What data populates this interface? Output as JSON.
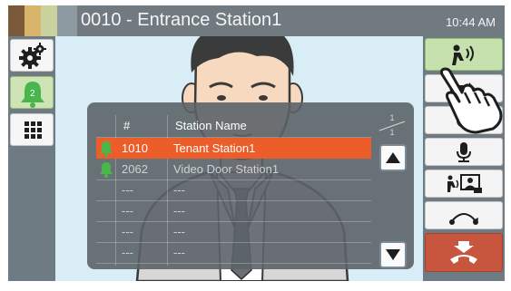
{
  "title_bar": {
    "station_title": "0010 - Entrance Station1",
    "time": "10:44 AM"
  },
  "left_panel": {
    "settings_button": "gear-icon",
    "call_status_button": {
      "icon": "bell-icon",
      "badge": "2"
    },
    "keypad_button": "keypad-icon"
  },
  "station_list": {
    "columns": {
      "number": "#",
      "name": "Station Name"
    },
    "page": {
      "current": "1",
      "total": "1"
    },
    "rows": [
      {
        "status_icon": "bell-icon",
        "number": "1010",
        "name": "Tenant Station1",
        "selected": true
      },
      {
        "status_icon": "bell-icon",
        "number": "2062",
        "name": "Video Door Station1",
        "selected": false
      },
      {
        "number": "---",
        "name": "---"
      },
      {
        "number": "---",
        "name": "---"
      },
      {
        "number": "---",
        "name": "---"
      },
      {
        "number": "---",
        "name": "---"
      }
    ],
    "colors": {
      "selected_row": "#ec5d29",
      "bell_icon": "#48b64a"
    }
  },
  "right_panel": {
    "buttons": [
      "call-individual-icon",
      "phone-transfer-icon",
      "record-icon",
      "microphone-icon",
      "page-display-icon",
      "hold-icon",
      "end-call-icon"
    ],
    "colors": {
      "active": "#c6e1ad",
      "end_call": "#c8553d"
    }
  }
}
